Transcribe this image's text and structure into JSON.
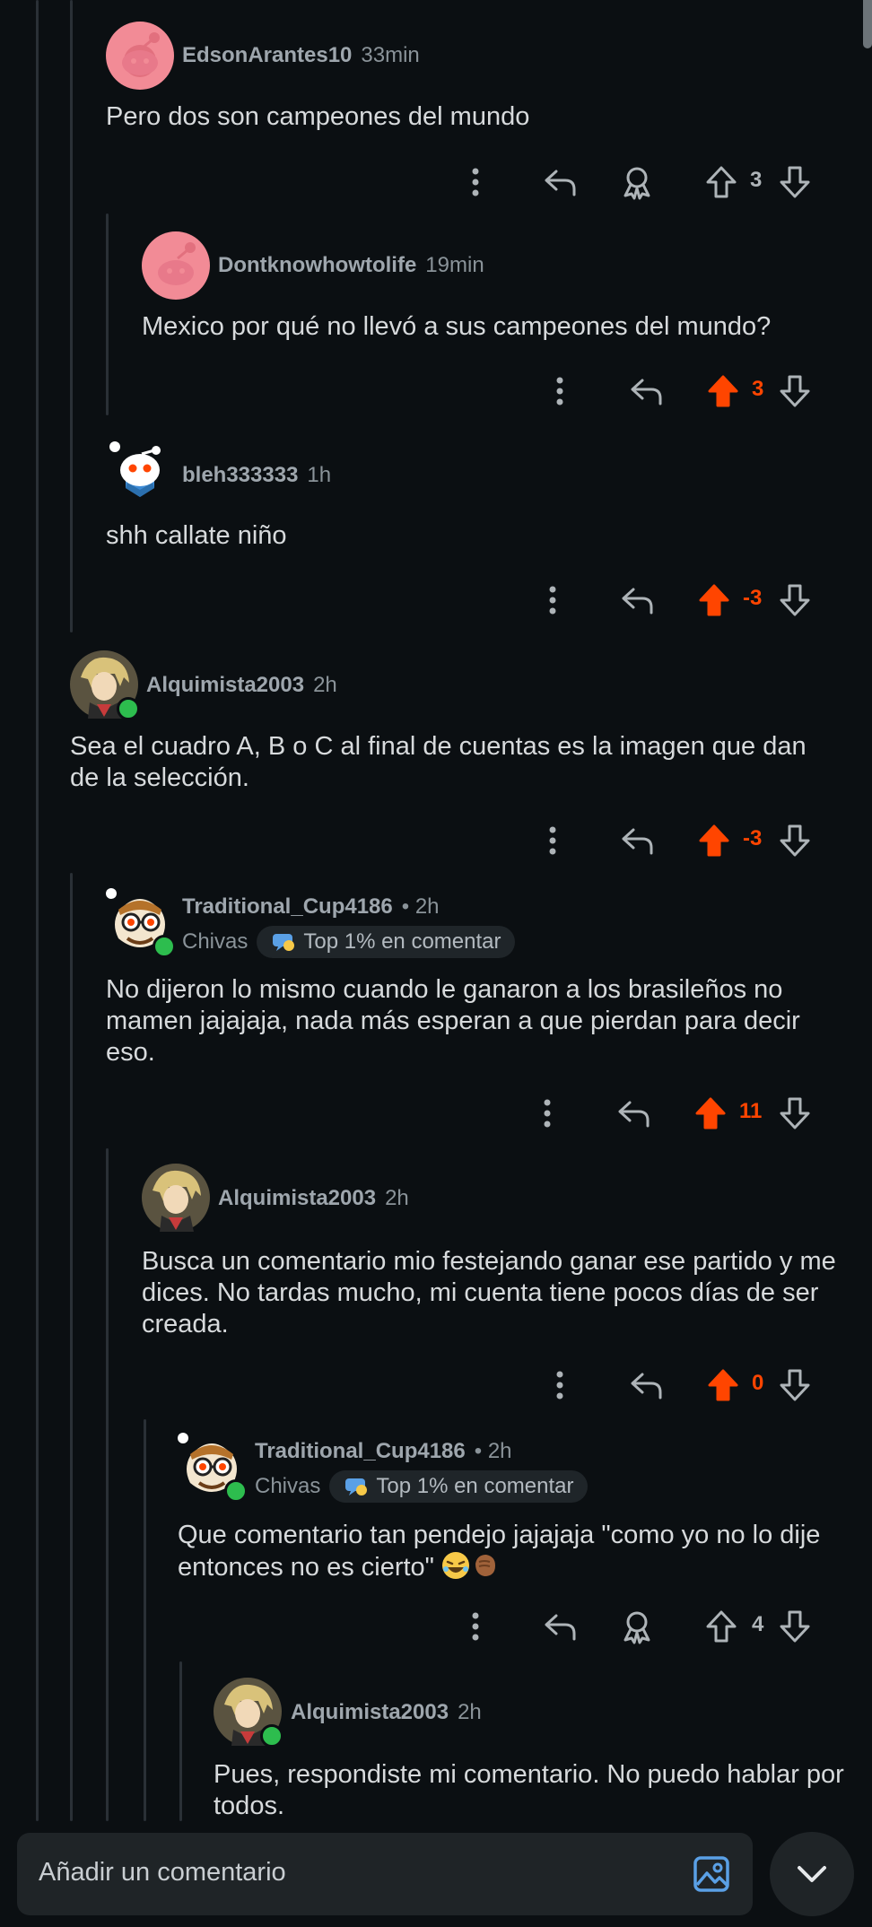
{
  "comments": [
    {
      "username": "EdsonArantes10",
      "time": "33min",
      "flair": "",
      "badge": "",
      "text": "Pero dos son campeones del mundo",
      "score": "3"
    },
    {
      "username": "Dontknowhowtolife",
      "time": "19min",
      "flair": "",
      "badge": "",
      "text": "Mexico por qué no llevó a sus campeones del mundo?",
      "score": "3"
    },
    {
      "username": "bleh333333",
      "time": "1h",
      "flair": "",
      "badge": "",
      "text": "shh callate niño",
      "score": "-3"
    },
    {
      "username": "Alquimista2003",
      "time": "2h",
      "flair": "",
      "badge": "",
      "text": "Sea el cuadro A, B o C al final de cuentas es la imagen que dan de la selección.",
      "score": "-3"
    },
    {
      "username": "Traditional_Cup4186",
      "time": "• 2h",
      "flair": "Chivas",
      "badge": "Top 1% en comentar",
      "text": "No dijeron lo mismo cuando le ganaron a los brasileños no mamen jajajaja, nada más esperan a que pierdan para decir eso.",
      "score": "11"
    },
    {
      "username": "Alquimista2003",
      "time": "2h",
      "flair": "",
      "badge": "",
      "text": "Busca un comentario mio festejando ganar ese partido y me dices. No tardas mucho, mi cuenta tiene pocos días de ser creada.",
      "score": "0"
    },
    {
      "username": "Traditional_Cup4186",
      "time": "• 2h",
      "flair": "Chivas",
      "badge": "Top 1% en comentar",
      "text": "Que comentario tan pendejo jajajaja \"como yo no lo dije entonces no es cierto\"",
      "score": "4"
    },
    {
      "username": "Alquimista2003",
      "time": "2h",
      "flair": "",
      "badge": "",
      "text": "Pues, respondiste mi comentario. No puedo hablar por todos.",
      "score": ""
    }
  ],
  "composer": {
    "placeholder": "Añadir un comentario"
  },
  "colors": {
    "upvoted": "#ff4500",
    "background": "#0b0f12",
    "online": "#2dbd4e"
  },
  "icons": [
    "more-vertical-icon",
    "reply-icon",
    "award-icon",
    "upvote-icon",
    "downvote-icon",
    "image-icon",
    "chevron-down-icon",
    "laughing-emoji-icon",
    "fist-emoji-icon"
  ]
}
